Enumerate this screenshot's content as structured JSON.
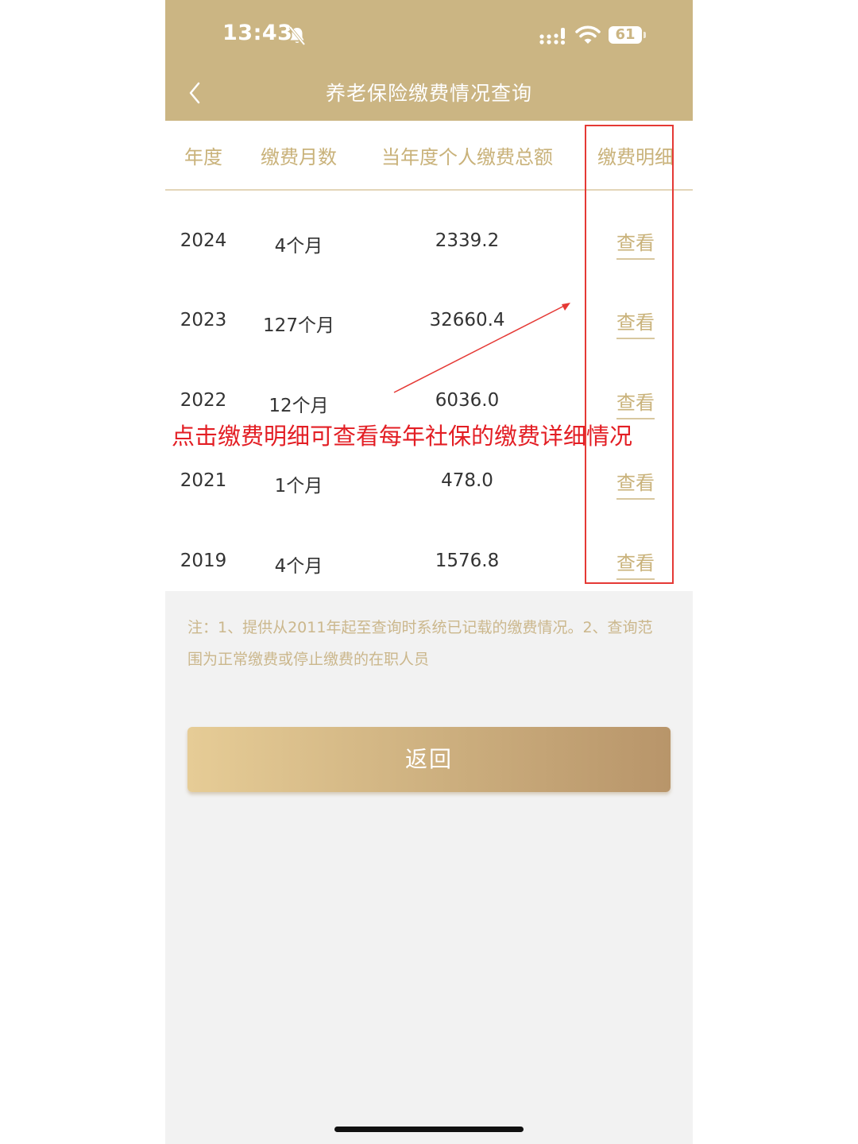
{
  "status_bar": {
    "time": "13:43",
    "battery": "61"
  },
  "header": {
    "title": "养老保险缴费情况查询"
  },
  "table": {
    "columns": [
      "年度",
      "缴费月数",
      "当年度个人缴费总额",
      "缴费明细"
    ],
    "rows": [
      {
        "year": "2024",
        "months": "4个月",
        "amount": "2339.2",
        "action": "查看"
      },
      {
        "year": "2023",
        "months": "127个月",
        "amount": "32660.4",
        "action": "查看"
      },
      {
        "year": "2022",
        "months": "12个月",
        "amount": "6036.0",
        "action": "查看"
      },
      {
        "year": "2021",
        "months": "1个月",
        "amount": "478.0",
        "action": "查看"
      },
      {
        "year": "2019",
        "months": "4个月",
        "amount": "1576.8",
        "action": "查看"
      }
    ]
  },
  "annotation": {
    "text": "点击缴费明细可查看每年社保的缴费详细情况",
    "color": "#e31e24"
  },
  "note": {
    "text": "注：1、提供从2011年起至查询时系统已记载的缴费情况。2、查询范围为正常缴费或停止缴费的在职人员"
  },
  "buttons": {
    "return_label": "返回"
  },
  "colors": {
    "header_bg": "#cbb583",
    "accent_gold": "#c9b27a",
    "page_bg": "#f2f2f2"
  }
}
